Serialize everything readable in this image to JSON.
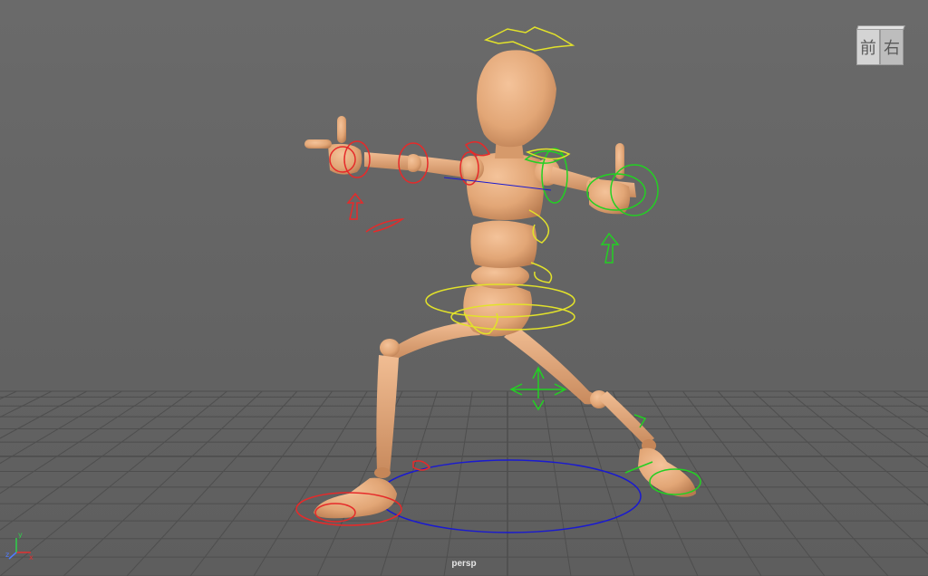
{
  "viewport": {
    "camera_label": "persp",
    "background": "#6a6a6a"
  },
  "viewcube": {
    "front_label": "前",
    "right_label": "右"
  },
  "axis_gizmo": {
    "x_label": "x",
    "y_label": "y",
    "z_label": "z",
    "x_color": "#e23030",
    "y_color": "#2fd04a",
    "z_color": "#4f7bff"
  },
  "controls": {
    "left_color": "#e62a2a",
    "right_color": "#23d023",
    "center_color": "#e2e22a",
    "root_color": "#1a1ad0"
  },
  "character": {
    "skin_color": "#e4a778",
    "shade_color": "#b97d52"
  }
}
